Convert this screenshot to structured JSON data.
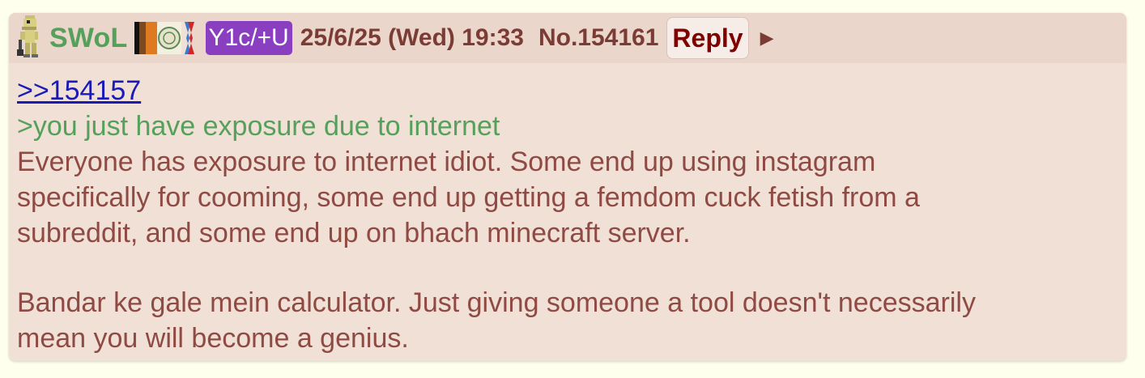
{
  "post": {
    "poster_name": "SWoL",
    "poster_id": "Y1c/+U",
    "date": "25/6/25 (Wed) 19:33",
    "number": "No.154161",
    "reply_label": "Reply",
    "expand_glyph": "▶",
    "icons": {
      "avatar": "pixel-character-icon",
      "flag": "flag-icon",
      "arrow": "triangle-right-icon"
    },
    "colors": {
      "name": "#55a05a",
      "id_badge": "#8a3fc0",
      "body_text": "#8f4a44",
      "quote": "#55a05a",
      "link": "#1a1ab8",
      "post_bg": "#f0e0d6",
      "header_bg": "#ead6ca"
    },
    "body": {
      "quotelink": ">>154157",
      "greentext": ">you just have exposure due to internet",
      "paragraph1": [
        "Everyone has exposure to internet idiot. Some end up using instagram",
        "specifically for cooming, some end up getting a femdom cuck fetish from a",
        "subreddit, and some end up on bhach minecraft server."
      ],
      "paragraph2": [
        "Bandar ke gale mein calculator. Just giving someone a tool doesn't necessarily",
        "mean you will become a genius."
      ]
    }
  }
}
